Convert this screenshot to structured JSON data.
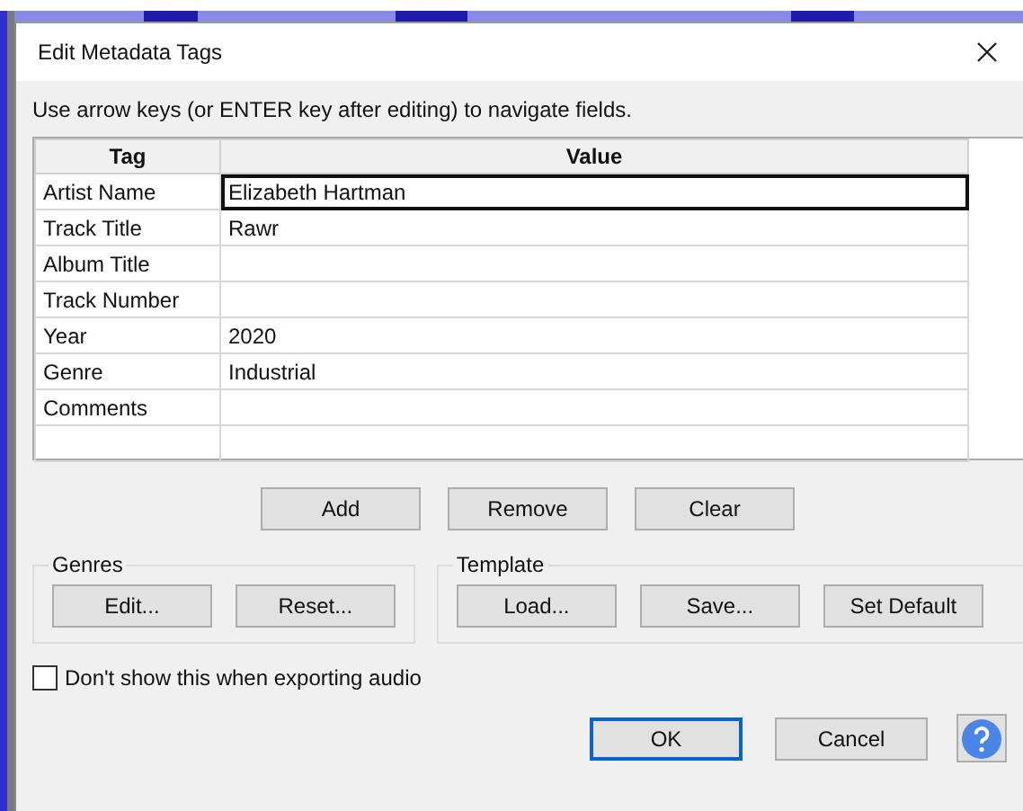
{
  "window": {
    "title": "Edit Metadata Tags"
  },
  "instruction": "Use arrow keys (or ENTER key after editing) to navigate fields.",
  "table": {
    "columns": [
      "Tag",
      "Value"
    ],
    "rows": [
      {
        "tag": "Artist Name",
        "value": "Elizabeth Hartman",
        "focused": true
      },
      {
        "tag": "Track Title",
        "value": "Rawr",
        "focused": false
      },
      {
        "tag": "Album Title",
        "value": "",
        "focused": false
      },
      {
        "tag": "Track Number",
        "value": "",
        "focused": false
      },
      {
        "tag": "Year",
        "value": "2020",
        "focused": false
      },
      {
        "tag": "Genre",
        "value": "Industrial",
        "focused": false
      },
      {
        "tag": "Comments",
        "value": "",
        "focused": false
      },
      {
        "tag": "",
        "value": "",
        "focused": false
      }
    ]
  },
  "row_buttons": [
    "Add",
    "Remove",
    "Clear"
  ],
  "genres": {
    "title": "Genres",
    "buttons": [
      "Edit...",
      "Reset..."
    ]
  },
  "template": {
    "title": "Template",
    "buttons": [
      "Load...",
      "Save...",
      "Set Default"
    ]
  },
  "dont_show": {
    "label": "Don't show this when exporting audio",
    "checked": false
  },
  "footer_buttons": [
    {
      "label": "OK",
      "default": true
    },
    {
      "label": "Cancel",
      "default": false
    }
  ]
}
